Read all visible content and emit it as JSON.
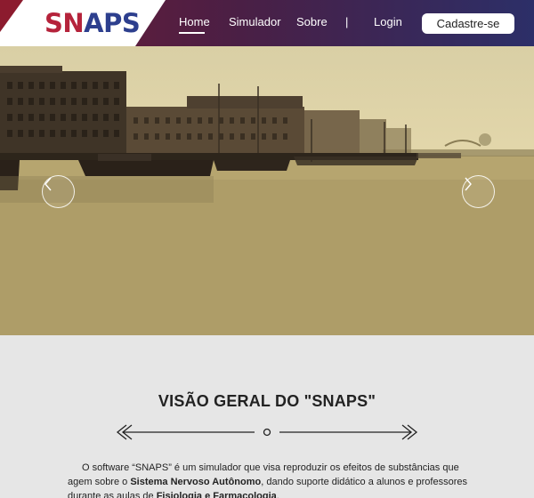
{
  "brand": {
    "logo_first": "SN",
    "logo_rest": "APS"
  },
  "nav": {
    "home": "Home",
    "simulator": "Simulador",
    "about": "Sobre",
    "separator": "|",
    "login": "Login",
    "signup": "Cadastre-se",
    "active": "Home"
  },
  "hero": {
    "scene": "harbor-photo",
    "prev_icon": "chevron-left-icon",
    "next_icon": "chevron-right-icon"
  },
  "overview": {
    "title": "VISÃO GERAL DO \"SNAPS\"",
    "p_part1": "O software “SNAPS” é um simulador que visa reproduzir os efeitos de substâncias que agem sobre o ",
    "p_bold1": "Sistema Nervoso Autônomo",
    "p_part2": ", dando suporte didático a alunos e professores durante as aulas de ",
    "p_bold2": "Fisiologia e Farmacologia",
    "p_part3": "."
  },
  "colors": {
    "nav_start": "#6e1b35",
    "nav_end": "#2c2f68",
    "logo_red": "#b5233b",
    "logo_blue": "#2d3f8e",
    "section_bg": "#e6e6e6"
  }
}
